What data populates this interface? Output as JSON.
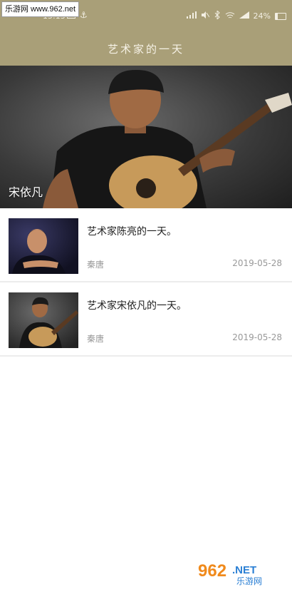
{
  "watermark_top": "乐游网 www.962.net",
  "status": {
    "time": "15:13",
    "battery": "24%",
    "battery_level": 0.24
  },
  "header": {
    "title": "艺术家的一天"
  },
  "hero": {
    "caption": "宋依凡"
  },
  "articles": [
    {
      "title": "艺术家陈亮的一天。",
      "source": "秦唐",
      "date": "2019-05-28"
    },
    {
      "title": "艺术家宋依凡的一天。",
      "source": "秦唐",
      "date": "2019-05-28"
    }
  ],
  "watermark_bottom": {
    "logo": "962",
    "net": ".NET",
    "name": "乐游网"
  },
  "colors": {
    "header_bg": "#a99f78",
    "divider": "#ececec",
    "meta_text": "#999999"
  }
}
